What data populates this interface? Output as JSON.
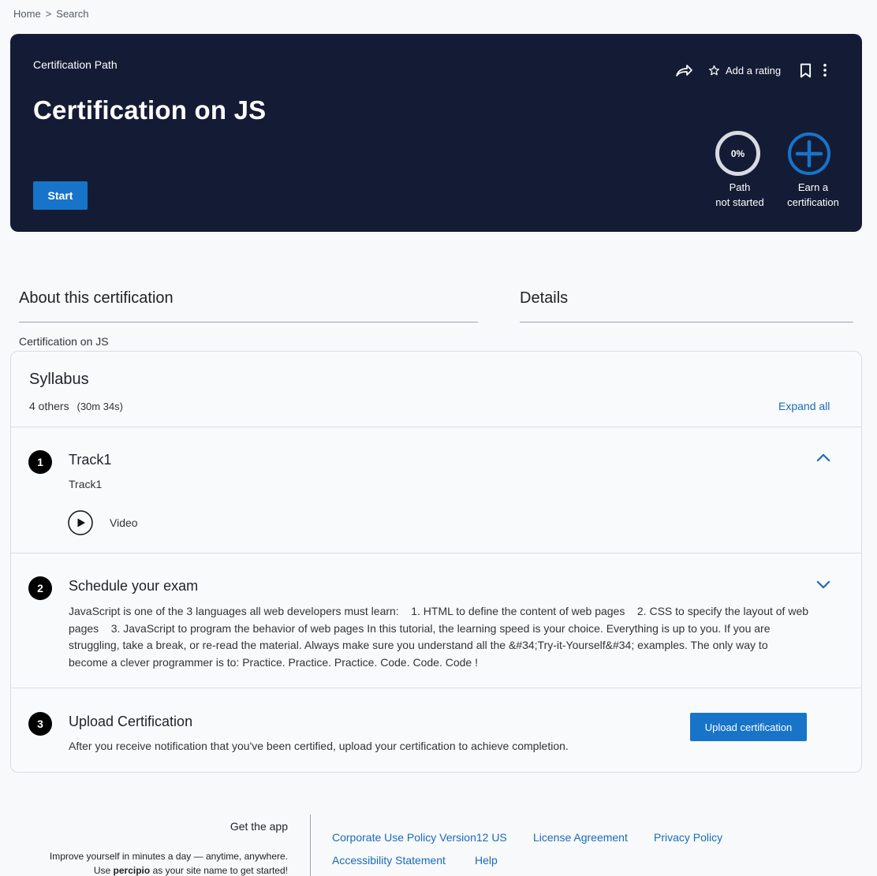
{
  "breadcrumb": {
    "home": "Home",
    "separator": ">",
    "current": "Search"
  },
  "hero": {
    "kicker": "Certification Path",
    "title": "Certification on JS",
    "start_label": "Start",
    "add_rating_label": "Add a rating",
    "progress_value": "0%",
    "path_status_line1": "Path",
    "path_status_line2": "not started",
    "earn_line1": "Earn a",
    "earn_line2": "certification"
  },
  "about": {
    "heading": "About this certification",
    "text": "Certification on JS"
  },
  "details": {
    "heading": "Details"
  },
  "syllabus": {
    "title": "Syllabus",
    "count": "4 others",
    "duration": "(30m 34s)",
    "expand_all": "Expand all",
    "steps": [
      {
        "number": "1",
        "title": "Track1",
        "subtitle": "Track1",
        "item_label": "Video"
      },
      {
        "number": "2",
        "title": "Schedule your exam",
        "description": "JavaScript is one of the 3 languages all web developers must learn:    1. HTML to define the content of web pages    2. CSS to specify the layout of web pages    3. JavaScript to program the behavior of web pages In this tutorial, the learning speed is your choice. Everything is up to you. If you are struggling, take a break, or re-read the material. Always make sure you understand all the &#34;Try-it-Yourself&#34; examples. The only way to become a clever programmer is to: Practice. Practice. Practice. Code. Code. Code !"
      },
      {
        "number": "3",
        "title": "Upload Certification",
        "description": "After you receive notification that you've been certified, upload your certification to achieve completion.",
        "button_label": "Upload certification"
      }
    ]
  },
  "footer": {
    "app_title": "Get the app",
    "app_line1": "Improve yourself in minutes a day — anytime, anywhere.",
    "app_line2_pre": "Use ",
    "app_line2_brand": "percipio",
    "app_line2_post": " as your site name to get started!",
    "links": [
      "Corporate Use Policy Version12 US",
      "License Agreement",
      "Privacy Policy",
      "Accessibility Statement",
      "Help"
    ]
  },
  "colors": {
    "hero_bg": "#141c35",
    "accent": "#1874c9",
    "link": "#1b6ab8"
  }
}
